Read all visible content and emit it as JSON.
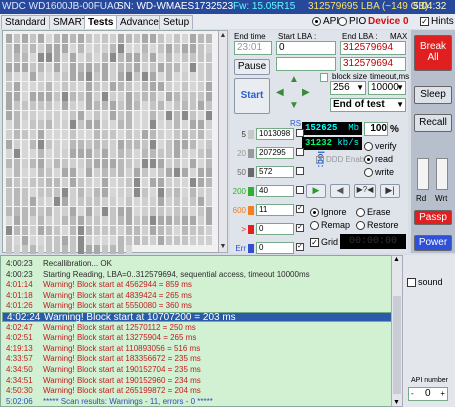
{
  "titlebar": {
    "drive": "WDC WD1600JB-00FUA0",
    "sn": "SN: WD-WMAES1732523",
    "fw": "Fw: 15.05R15",
    "lba": "312579695 LBA (~149 GB)",
    "time": "5:04:32"
  },
  "tabs": [
    "Standard",
    "SMART",
    "Tests",
    "Advanced",
    "Setup"
  ],
  "active_tab": "Tests",
  "mode": {
    "api": "API",
    "pio": "PIO",
    "device": "Device 0",
    "hints": "Hints"
  },
  "controls": {
    "end_time_label": "End time",
    "end_time_value": "23:01",
    "start_lba_label": "Start LBA :",
    "start_lba_value": "0",
    "end_lba_label": "End LBA :",
    "end_lba_max": "MAX",
    "end_lba_value": "312579694",
    "pause": "Pause",
    "start": "Start",
    "lba_field_value": "312579694",
    "block_size_label": "block size",
    "block_size_value": "256",
    "timeout_label": "timeout,ms",
    "timeout_value": "10000",
    "end_action": "End of test",
    "break_all": "Break All",
    "sleep": "Sleep",
    "recall": "Recall",
    "rd": "Rd",
    "wrt": "Wrt",
    "passp": "Passp",
    "power": "Power",
    "rs": "RS",
    "to_log": "to log:"
  },
  "counts": [
    {
      "label": "5",
      "value": "1013098",
      "color": "#c8c8c8"
    },
    {
      "label": "20",
      "value": "207295",
      "color": "#9a9a9a"
    },
    {
      "label": "50",
      "value": "572",
      "color": "#6a6a6a"
    },
    {
      "label": "200",
      "value": "40",
      "color": "#30b030"
    },
    {
      "label": "600",
      "value": "11",
      "color": "#f08020"
    },
    {
      "label": ">",
      "value": "0",
      "color": "#e02020"
    },
    {
      "label": "Err",
      "value": "0",
      "color": "#3050d0"
    }
  ],
  "stats": {
    "mb": "152625",
    "mb_unit": "Mb",
    "percent": "100",
    "percent_unit": "%",
    "speed": "31232",
    "speed_unit": "kb/s",
    "ddd": "DDD Enable",
    "verify": "verify",
    "read": "read",
    "write": "write"
  },
  "actions": {
    "ignore": "Ignore",
    "erase": "Erase",
    "remap": "Remap",
    "restore": "Restore",
    "grid": "Grid",
    "timer": "00:00:00"
  },
  "log": [
    {
      "t": "4:00:23",
      "m": "Recallibration... OK",
      "k": "info"
    },
    {
      "t": "4:00:23",
      "m": "Starting Reading, LBA=0..312579694, sequential access, timeout 10000ms",
      "k": "info"
    },
    {
      "t": "4:01:14",
      "m": "Warning! Block start at 4562944 = 859 ms",
      "k": "warn"
    },
    {
      "t": "4:01:18",
      "m": "Warning! Block start at 4839424 = 265 ms",
      "k": "warn"
    },
    {
      "t": "4:01:26",
      "m": "Warning! Block start at 5550080 = 360 ms",
      "k": "warn"
    },
    {
      "t": "4:02:24",
      "m": "Warning! Block start at 10707200 = 203 ms",
      "k": "sel"
    },
    {
      "t": "4:02:47",
      "m": "Warning! Block start at 12570112 = 250 ms",
      "k": "warn"
    },
    {
      "t": "4:02:51",
      "m": "Warning! Block start at 13275904 = 265 ms",
      "k": "warn"
    },
    {
      "t": "4:19:13",
      "m": "Warning! Block start at 110893056 = 516 ms",
      "k": "warn"
    },
    {
      "t": "4:33:57",
      "m": "Warning! Block start at 183356672 = 235 ms",
      "k": "warn"
    },
    {
      "t": "4:34:50",
      "m": "Warning! Block start at 190152704 = 235 ms",
      "k": "warn"
    },
    {
      "t": "4:34:51",
      "m": "Warning! Block start at 190152960 = 234 ms",
      "k": "warn"
    },
    {
      "t": "4:50:30",
      "m": "Warning! Block start at 265199872 = 204 ms",
      "k": "warn"
    },
    {
      "t": "5:02:06",
      "m": "***** Scan results: Warnings - 11, errors - 0 *****",
      "k": "done"
    }
  ],
  "sound": "sound",
  "api_number_label": "API number",
  "api_number_value": "0"
}
